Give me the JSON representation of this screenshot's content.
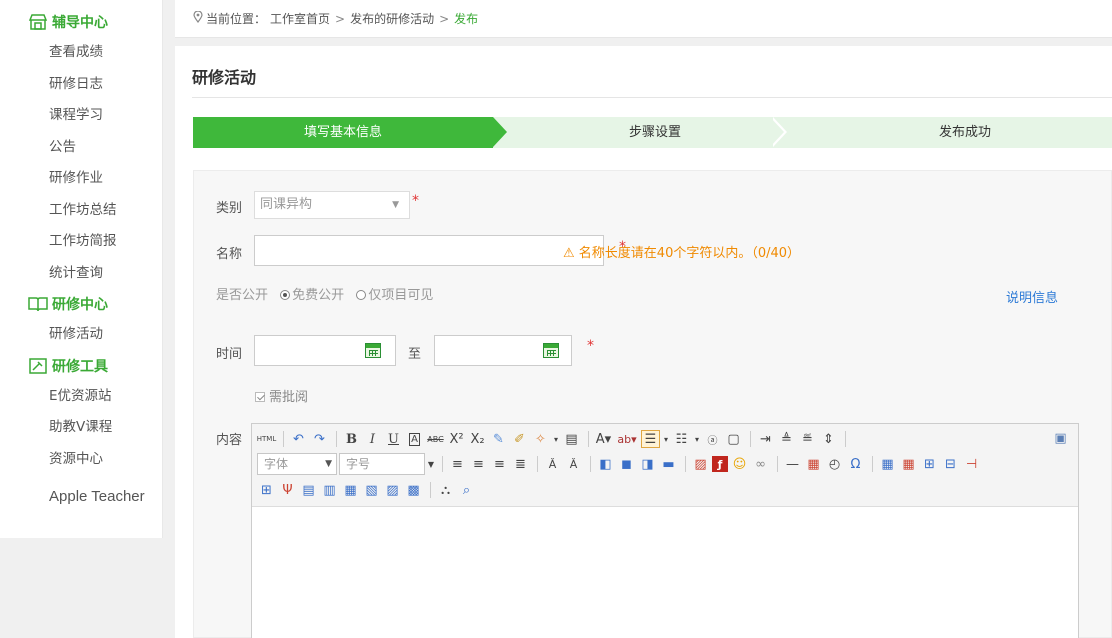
{
  "sidebar": {
    "sections": [
      {
        "title": "辅导中心",
        "icon": "store-icon",
        "items": [
          "查看成绩",
          "研修日志",
          "课程学习",
          "公告",
          "研修作业",
          "工作坊总结",
          "工作坊简报",
          "统计查询"
        ]
      },
      {
        "title": "研修中心",
        "icon": "book-icon",
        "items": [
          "研修活动"
        ]
      },
      {
        "title": "研修工具",
        "icon": "tools-icon",
        "items": [
          "E优资源站",
          "助教V课程",
          "资源中心",
          "Apple Teacher"
        ]
      }
    ]
  },
  "breadcrumb": {
    "prefix": "当前位置：",
    "items": [
      "工作室首页",
      "发布的研修活动"
    ],
    "current": "发布",
    "sep": ">"
  },
  "page_title": "研修活动",
  "steps": [
    "填写基本信息",
    "步骤设置",
    "发布成功"
  ],
  "form": {
    "category_label": "类别",
    "category_value": "同课异构",
    "name_label": "名称",
    "name_warning": "名称长度请在40个字符以内。（0/40）",
    "public_label": "是否公开",
    "public_options": [
      "免费公开",
      "仅项目可见"
    ],
    "desc_link": "说明信息",
    "time_label": "时间",
    "time_sep": "至",
    "need_review": "需批阅",
    "content_label": "内容",
    "required_mark": "*",
    "warn_icon": "⚠"
  },
  "editor": {
    "font_placeholder": "字体",
    "size_placeholder": "字号"
  },
  "colors": {
    "accent": "#3aa935",
    "warning": "#f08a00",
    "link": "#2e7bd6",
    "required": "#e03434"
  }
}
